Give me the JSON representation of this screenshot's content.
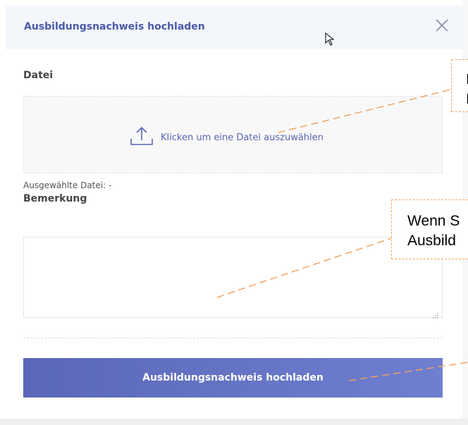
{
  "modal": {
    "title": "Ausbildungsnachweis hochladen",
    "file_section_label": "Datei",
    "dropzone_text": "Klicken um eine Datei auszuwählen",
    "selected_file_label": "Ausgewählte Datei: -",
    "remark_label": "Bemerkung",
    "remark_value": "",
    "submit_label": "Ausbildungsnachweis hochladen"
  },
  "callouts": {
    "top_right_lines": [
      "I",
      "I"
    ],
    "middle_right_lines": [
      "Wenn S",
      "Ausbild"
    ]
  },
  "colors": {
    "accent": "#4a5aa8",
    "button_gradient_start": "#5b68b8",
    "button_gradient_end": "#6f7fd0",
    "callout_border": "#f0a35e"
  },
  "icons": {
    "close": "close-icon",
    "upload": "upload-icon",
    "cursor": "mouse-cursor-icon",
    "resize": "resize-grip-icon"
  }
}
